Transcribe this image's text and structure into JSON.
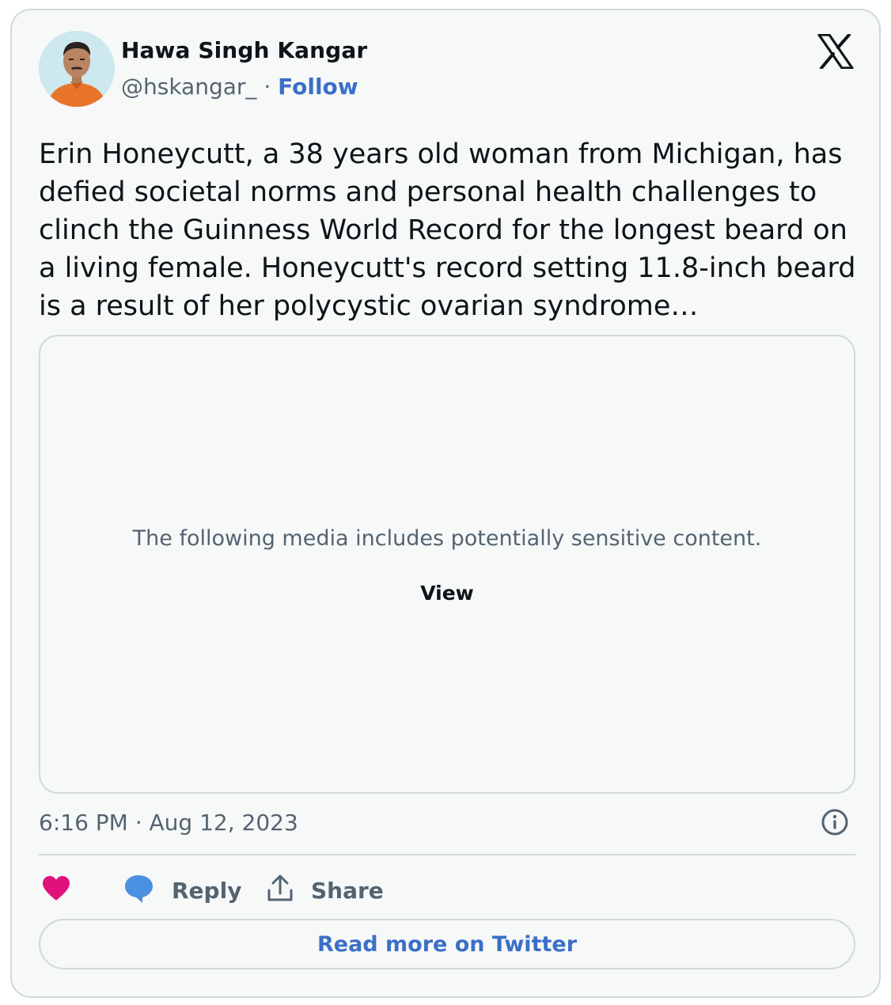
{
  "author": {
    "name": "Hawa Singh Kangar",
    "handle": "@hskangar_",
    "separator": "·",
    "follow_label": "Follow"
  },
  "tweet": {
    "text": "Erin Honeycutt, a 38 years old woman from Michigan, has defied societal norms and personal health challenges to clinch the Guinness World Record for the longest beard on a living female. Honeycutt's record setting 11.8-inch beard is a result of her polycystic ovarian syndrome…",
    "timestamp": "6:16 PM · Aug 12, 2023"
  },
  "media": {
    "notice": "The following media includes potentially sensitive content.",
    "view_label": "View"
  },
  "actions": {
    "reply_label": "Reply",
    "share_label": "Share"
  },
  "read_more_label": "Read more on Twitter",
  "colors": {
    "accent": "#3b6fc7",
    "like": "#e0117a",
    "reply_bubble": "#4a90e2",
    "muted": "#536471"
  },
  "icons": [
    "x-logo-icon",
    "info-icon",
    "heart-icon",
    "reply-bubble-icon",
    "share-icon"
  ]
}
